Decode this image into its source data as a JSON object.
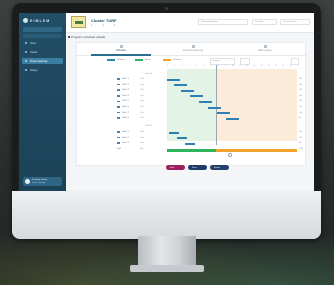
{
  "app": {
    "name": "EIMLEM"
  },
  "sidebar": {
    "items": [
      {
        "label": "Home"
      },
      {
        "label": "Assets"
      },
      {
        "label": "Project planning"
      },
      {
        "label": "Design"
      }
    ],
    "user": {
      "name": "Pradeep Kumar",
      "role": "Project manager"
    }
  },
  "header": {
    "title": "Cluster TURF",
    "breadcrumb": "1 · 2 · 3 · ·",
    "field_1": "Planned duration",
    "field_2": "Location",
    "field_3": "Current status"
  },
  "panel": {
    "title": "Program schedule (detail)"
  },
  "tabs": [
    {
      "label": "Schedule"
    },
    {
      "label": "Resource planning"
    },
    {
      "label": "Risk register"
    }
  ],
  "legend": [
    {
      "label": "Planned",
      "color": "#2e7fb4"
    },
    {
      "label": "Actual",
      "color": "#2fb35b"
    },
    {
      "label": "Forecast",
      "color": "#f2a12a"
    }
  ],
  "filter": {
    "label": "Timeline"
  },
  "timeline": {
    "columns": [
      "1",
      "2",
      "3",
      "4",
      "5",
      "6",
      "7",
      "8",
      "9",
      "10",
      "11",
      "12",
      "13",
      "14",
      "15",
      "16",
      "17",
      "18"
    ],
    "section_a": "Phase A",
    "section_b": "Phase B",
    "rows_a": [
      {
        "name": "Task 1.1",
        "value": "0.5w",
        "right": "12d"
      },
      {
        "name": "Task 1.2",
        "value": "1.0w",
        "right": "14d"
      },
      {
        "name": "Task 1.3",
        "value": "0.8w",
        "right": "10d"
      },
      {
        "name": "Task 1.4",
        "value": "1.2w",
        "right": "16d"
      },
      {
        "name": "Task 1.5",
        "value": "0.6w",
        "right": "11d"
      },
      {
        "name": "Task 1.6",
        "value": "0.9w",
        "right": "13d"
      },
      {
        "name": "Task 1.7",
        "value": "1.1w",
        "right": "15d"
      },
      {
        "name": "Task 1.8",
        "value": "0.7w",
        "right": "9d"
      }
    ],
    "rows_b": [
      {
        "name": "Task 2.1",
        "value": "0.8w",
        "right": "12d"
      },
      {
        "name": "Task 2.2",
        "value": "1.0w",
        "right": "14d"
      },
      {
        "name": "Task 2.3",
        "value": "0.6w",
        "right": "8d"
      }
    ],
    "summary": {
      "name": "Total",
      "value": "18w",
      "right": "118d"
    }
  },
  "actions": [
    {
      "label": "Back"
    },
    {
      "label": "Save"
    },
    {
      "label": "Export"
    }
  ]
}
